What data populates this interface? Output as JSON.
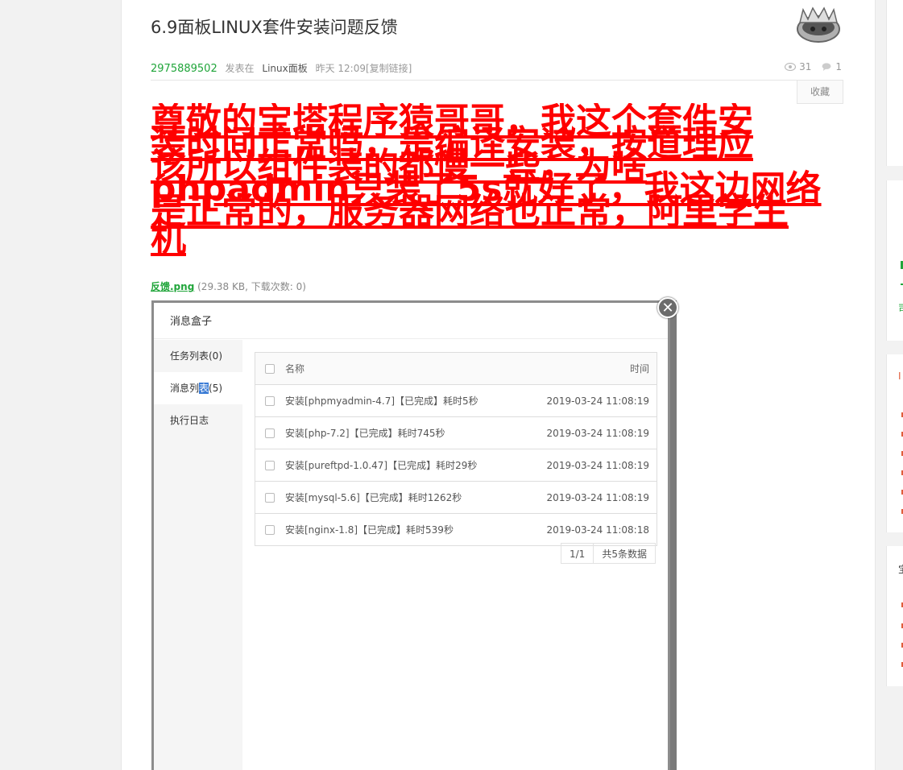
{
  "thread": {
    "title": "6.9面板LINUX套件安装问题反馈",
    "author": "2975889502",
    "posted_in": "发表在",
    "board": "Linux面板",
    "time": "昨天 12:09",
    "copy_link": "[复制链接]",
    "views": "31",
    "replies": "1",
    "favorite_label": "收藏"
  },
  "post": {
    "lines": [
      "尊敬的宝塔程序猿哥哥，我这个套件安",
      "装时间正常吗，是编译安装，按道理应",
      "该所以组件装的都慢一些，为啥",
      "phpadmin只装了5s就好了，我这边网络",
      "是正常的，服务器网络也正常，阿里学生",
      "机"
    ],
    "text_color": "#ff0000"
  },
  "attachment": {
    "filename": "反馈.png",
    "info": "(29.38 KB, 下载次数: 0)"
  },
  "message_box": {
    "title": "消息盒子",
    "side_tabs": [
      {
        "label": "任务列表(0)"
      },
      {
        "label_pre": "消息列",
        "label_hl": "表",
        "label_post": "(5)"
      },
      {
        "label": "执行日志"
      }
    ],
    "table_headers": {
      "name": "名称",
      "time": "时间"
    },
    "rows": [
      {
        "name": "安装[phpmyadmin-4.7]【已完成】耗时5秒",
        "time": "2019-03-24 11:08:19"
      },
      {
        "name": "安装[php-7.2]【已完成】耗时745秒",
        "time": "2019-03-24 11:08:19"
      },
      {
        "name": "安装[pureftpd-1.0.47]【已完成】耗时29秒",
        "time": "2019-03-24 11:08:19"
      },
      {
        "name": "安装[mysql-5.6]【已完成】耗时1262秒",
        "time": "2019-03-24 11:08:19"
      },
      {
        "name": "安装[nginx-1.8]【已完成】耗时539秒",
        "time": "2019-03-24 11:08:18"
      }
    ],
    "pager": {
      "page": "1/1",
      "total": "共5条数据"
    },
    "close_icon": "close-icon"
  },
  "sidebar": {
    "card2_text": "司",
    "card3_text": "I",
    "card4_text": "宝"
  },
  "colors": {
    "accent": "#20a53a",
    "post_text": "#ff0000"
  }
}
